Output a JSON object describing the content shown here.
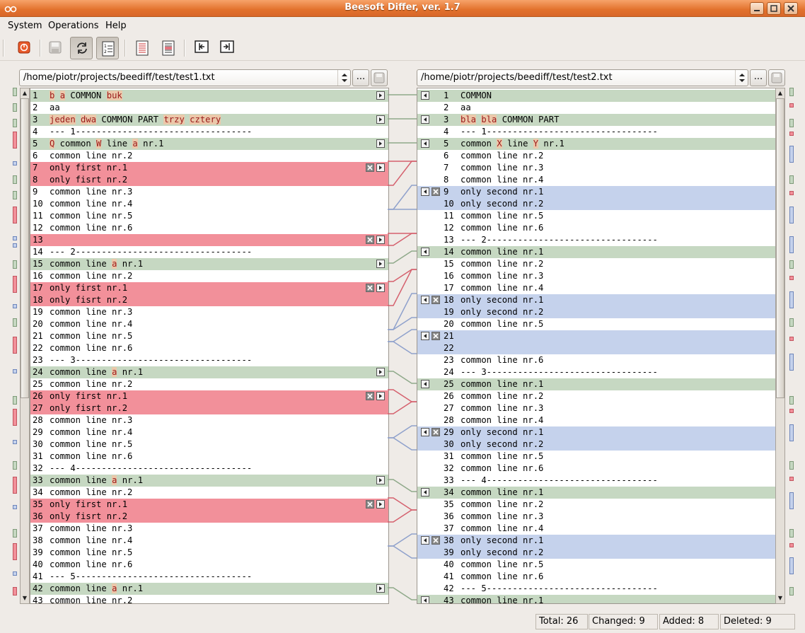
{
  "window": {
    "title": "Beesoft Differ, ver. 1.7"
  },
  "menu": {
    "system": "System",
    "operations": "Operations",
    "help": "Help"
  },
  "toolbar_icons": [
    "power-icon",
    "save-icon",
    "refresh-icon",
    "line-numbers-icon",
    "left-doc-icon",
    "right-doc-icon",
    "prev-diff-icon",
    "next-diff-icon"
  ],
  "left_file": {
    "path": "/home/piotr/projects/beediff/test/test1.txt",
    "browse": "..."
  },
  "right_file": {
    "path": "/home/piotr/projects/beediff/test/test2.txt",
    "browse": "..."
  },
  "colors": {
    "changed": "#c6d8c2",
    "deleted": "#f2909a",
    "added": "#c5d2ec"
  },
  "left_lines": [
    {
      "n": "1",
      "segs": [
        [
          "b",
          "h"
        ],
        [
          " "
        ],
        [
          "a",
          "h"
        ],
        [
          " COMMON "
        ],
        [
          "buk",
          "h"
        ]
      ],
      "t": "c"
    },
    {
      "n": "2",
      "segs": [
        [
          "aa"
        ]
      ]
    },
    {
      "n": "3",
      "segs": [
        [
          "jeden",
          "h"
        ],
        [
          " "
        ],
        [
          "dwa",
          "h"
        ],
        [
          " COMMON PART "
        ],
        [
          "trzy",
          "h"
        ],
        [
          " "
        ],
        [
          "cztery",
          "h"
        ]
      ],
      "t": "c"
    },
    {
      "n": "4",
      "segs": [
        [
          "--- 1----------------------------------"
        ]
      ]
    },
    {
      "n": "5",
      "segs": [
        [
          "Q",
          "h"
        ],
        [
          " common "
        ],
        [
          "W",
          "h"
        ],
        [
          " line "
        ],
        [
          "a",
          "h"
        ],
        [
          " nr.1"
        ]
      ],
      "t": "c"
    },
    {
      "n": "6",
      "segs": [
        [
          "common line nr.2"
        ]
      ]
    },
    {
      "n": "7",
      "segs": [
        [
          "only first nr.1"
        ]
      ],
      "t": "d"
    },
    {
      "n": "8",
      "segs": [
        [
          "only fisrt nr.2"
        ]
      ],
      "t": "d"
    },
    {
      "n": "9",
      "segs": [
        [
          "common line nr.3"
        ]
      ]
    },
    {
      "n": "10",
      "segs": [
        [
          "common line nr.4"
        ]
      ]
    },
    {
      "n": "11",
      "segs": [
        [
          "common line nr.5"
        ]
      ]
    },
    {
      "n": "12",
      "segs": [
        [
          "common line nr.6"
        ]
      ]
    },
    {
      "n": "13",
      "segs": [
        [
          ""
        ]
      ],
      "t": "d"
    },
    {
      "n": "14",
      "segs": [
        [
          "--- 2----------------------------------"
        ]
      ]
    },
    {
      "n": "15",
      "segs": [
        [
          "common line "
        ],
        [
          "a",
          "h"
        ],
        [
          " nr.1"
        ]
      ],
      "t": "c"
    },
    {
      "n": "16",
      "segs": [
        [
          "common line nr.2"
        ]
      ]
    },
    {
      "n": "17",
      "segs": [
        [
          "only first nr.1"
        ]
      ],
      "t": "d"
    },
    {
      "n": "18",
      "segs": [
        [
          "only fisrt nr.2"
        ]
      ],
      "t": "d"
    },
    {
      "n": "19",
      "segs": [
        [
          "common line nr.3"
        ]
      ]
    },
    {
      "n": "20",
      "segs": [
        [
          "common line nr.4"
        ]
      ]
    },
    {
      "n": "21",
      "segs": [
        [
          "common line nr.5"
        ]
      ]
    },
    {
      "n": "22",
      "segs": [
        [
          "common line nr.6"
        ]
      ]
    },
    {
      "n": "23",
      "segs": [
        [
          "--- 3----------------------------------"
        ]
      ]
    },
    {
      "n": "24",
      "segs": [
        [
          "common line "
        ],
        [
          "a",
          "h"
        ],
        [
          " nr.1"
        ]
      ],
      "t": "c"
    },
    {
      "n": "25",
      "segs": [
        [
          "common line nr.2"
        ]
      ]
    },
    {
      "n": "26",
      "segs": [
        [
          "only first nr.1"
        ]
      ],
      "t": "d"
    },
    {
      "n": "27",
      "segs": [
        [
          "only fisrt nr.2"
        ]
      ],
      "t": "d"
    },
    {
      "n": "28",
      "segs": [
        [
          "common line nr.3"
        ]
      ]
    },
    {
      "n": "29",
      "segs": [
        [
          "common line nr.4"
        ]
      ]
    },
    {
      "n": "30",
      "segs": [
        [
          "common line nr.5"
        ]
      ]
    },
    {
      "n": "31",
      "segs": [
        [
          "common line nr.6"
        ]
      ]
    },
    {
      "n": "32",
      "segs": [
        [
          "--- 4----------------------------------"
        ]
      ]
    },
    {
      "n": "33",
      "segs": [
        [
          "common line "
        ],
        [
          "a",
          "h"
        ],
        [
          " nr.1"
        ]
      ],
      "t": "c"
    },
    {
      "n": "34",
      "segs": [
        [
          "common line nr.2"
        ]
      ]
    },
    {
      "n": "35",
      "segs": [
        [
          "only first nr.1"
        ]
      ],
      "t": "d"
    },
    {
      "n": "36",
      "segs": [
        [
          "only fisrt nr.2"
        ]
      ],
      "t": "d"
    },
    {
      "n": "37",
      "segs": [
        [
          "common line nr.3"
        ]
      ]
    },
    {
      "n": "38",
      "segs": [
        [
          "common line nr.4"
        ]
      ]
    },
    {
      "n": "39",
      "segs": [
        [
          "common line nr.5"
        ]
      ]
    },
    {
      "n": "40",
      "segs": [
        [
          "common line nr.6"
        ]
      ]
    },
    {
      "n": "41",
      "segs": [
        [
          "--- 5----------------------------------"
        ]
      ]
    },
    {
      "n": "42",
      "segs": [
        [
          "common line "
        ],
        [
          "a",
          "h"
        ],
        [
          " nr.1"
        ]
      ],
      "t": "c"
    },
    {
      "n": "43",
      "segs": [
        [
          "common line nr.2"
        ]
      ]
    }
  ],
  "right_lines": [
    {
      "n": "1",
      "segs": [
        [
          "COMMON"
        ]
      ],
      "t": "c"
    },
    {
      "n": "2",
      "segs": [
        [
          "aa"
        ]
      ]
    },
    {
      "n": "3",
      "segs": [
        [
          "bla",
          "h"
        ],
        [
          " "
        ],
        [
          "bla",
          "h"
        ],
        [
          " COMMON PART"
        ]
      ],
      "t": "c"
    },
    {
      "n": "4",
      "segs": [
        [
          "--- 1---------------------------------"
        ]
      ]
    },
    {
      "n": "5",
      "segs": [
        [
          "common "
        ],
        [
          "X",
          "h"
        ],
        [
          " line "
        ],
        [
          "Y",
          "h"
        ],
        [
          " nr.1"
        ]
      ],
      "t": "c"
    },
    {
      "n": "6",
      "segs": [
        [
          "common line nr.2"
        ]
      ]
    },
    {
      "n": "7",
      "segs": [
        [
          "common line nr.3"
        ]
      ]
    },
    {
      "n": "8",
      "segs": [
        [
          "common line nr.4"
        ]
      ]
    },
    {
      "n": "9",
      "segs": [
        [
          "only second nr.1"
        ]
      ],
      "t": "a"
    },
    {
      "n": "10",
      "segs": [
        [
          "only second nr.2"
        ]
      ],
      "t": "a"
    },
    {
      "n": "11",
      "segs": [
        [
          "common line nr.5"
        ]
      ]
    },
    {
      "n": "12",
      "segs": [
        [
          "common line nr.6"
        ]
      ]
    },
    {
      "n": "13",
      "segs": [
        [
          "--- 2---------------------------------"
        ]
      ]
    },
    {
      "n": "14",
      "segs": [
        [
          "common line nr.1"
        ]
      ],
      "t": "c"
    },
    {
      "n": "15",
      "segs": [
        [
          "common line nr.2"
        ]
      ]
    },
    {
      "n": "16",
      "segs": [
        [
          "common line nr.3"
        ]
      ]
    },
    {
      "n": "17",
      "segs": [
        [
          "common line nr.4"
        ]
      ]
    },
    {
      "n": "18",
      "segs": [
        [
          "only second nr.1"
        ]
      ],
      "t": "a"
    },
    {
      "n": "19",
      "segs": [
        [
          "only second nr.2"
        ]
      ],
      "t": "a"
    },
    {
      "n": "20",
      "segs": [
        [
          "common line nr.5"
        ]
      ]
    },
    {
      "n": "21",
      "segs": [
        [
          ""
        ]
      ],
      "t": "a"
    },
    {
      "n": "22",
      "segs": [
        [
          ""
        ]
      ],
      "t": "a"
    },
    {
      "n": "23",
      "segs": [
        [
          "common line nr.6"
        ]
      ]
    },
    {
      "n": "24",
      "segs": [
        [
          "--- 3---------------------------------"
        ]
      ]
    },
    {
      "n": "25",
      "segs": [
        [
          "common line nr.1"
        ]
      ],
      "t": "c"
    },
    {
      "n": "26",
      "segs": [
        [
          "common line nr.2"
        ]
      ]
    },
    {
      "n": "27",
      "segs": [
        [
          "common line nr.3"
        ]
      ]
    },
    {
      "n": "28",
      "segs": [
        [
          "common line nr.4"
        ]
      ]
    },
    {
      "n": "29",
      "segs": [
        [
          "only second nr.1"
        ]
      ],
      "t": "a"
    },
    {
      "n": "30",
      "segs": [
        [
          "only second nr.2"
        ]
      ],
      "t": "a"
    },
    {
      "n": "31",
      "segs": [
        [
          "common line nr.5"
        ]
      ]
    },
    {
      "n": "32",
      "segs": [
        [
          "common line nr.6"
        ]
      ]
    },
    {
      "n": "33",
      "segs": [
        [
          "--- 4---------------------------------"
        ]
      ]
    },
    {
      "n": "34",
      "segs": [
        [
          "common line nr.1"
        ]
      ],
      "t": "c"
    },
    {
      "n": "35",
      "segs": [
        [
          "common line nr.2"
        ]
      ]
    },
    {
      "n": "36",
      "segs": [
        [
          "common line nr.3"
        ]
      ]
    },
    {
      "n": "37",
      "segs": [
        [
          "common line nr.4"
        ]
      ]
    },
    {
      "n": "38",
      "segs": [
        [
          "only second nr.1"
        ]
      ],
      "t": "a"
    },
    {
      "n": "39",
      "segs": [
        [
          "only second nr.2"
        ]
      ],
      "t": "a"
    },
    {
      "n": "40",
      "segs": [
        [
          "common line nr.5"
        ]
      ]
    },
    {
      "n": "41",
      "segs": [
        [
          "common line nr.6"
        ]
      ]
    },
    {
      "n": "42",
      "segs": [
        [
          "--- 5---------------------------------"
        ]
      ]
    },
    {
      "n": "43",
      "segs": [
        [
          "common line nr.1"
        ]
      ],
      "t": "c"
    }
  ],
  "status": {
    "total": "Total: 26",
    "changed": "Changed: 9",
    "added": "Added: 8",
    "deleted": "Deleted: 9"
  }
}
